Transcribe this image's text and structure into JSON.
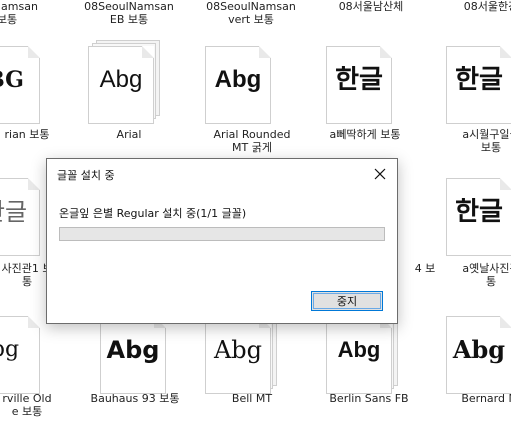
{
  "tiles_top_row_labels": [
    {
      "text": "oulNamsan\n보통"
    },
    {
      "text": "08SeoulNamsan\nEB 보통"
    },
    {
      "text": "08SeoulNamsan\nvert 보통"
    },
    {
      "text": "08서울남산체"
    },
    {
      "text": "08서울한강"
    }
  ],
  "tiles_row1": [
    {
      "sample": "BG",
      "label": "rian 보통",
      "style": "serif-bold"
    },
    {
      "sample": "Abg",
      "label": "Arial",
      "style": "sans"
    },
    {
      "sample": "Abg",
      "label": "Arial Rounded\nMT 굵게",
      "style": "sans-bold"
    },
    {
      "sample": "한글",
      "label": "a뻬딱하게 보통",
      "style": "korean"
    },
    {
      "sample": "한글",
      "label": "a시월구일실\n보통",
      "style": "korean"
    }
  ],
  "tiles_row2": [
    {
      "sample": "한글",
      "label": "사진관1 보\n통",
      "style": "korean-light"
    },
    {
      "sample": "",
      "label": "4 보",
      "style": "hidden"
    },
    {
      "sample": "한글",
      "label": "a옛날사진관\n통",
      "style": "korean"
    }
  ],
  "tiles_row3": [
    {
      "sample": "bg",
      "label": "rville Old\ne 보통",
      "style": "serif"
    },
    {
      "sample": "Abg",
      "label": "Bauhaus 93 보통",
      "style": "bauhaus"
    },
    {
      "sample": "Abg",
      "label": "Bell MT",
      "style": "serif"
    },
    {
      "sample": "Abg",
      "label": "Berlin Sans FB",
      "style": "sans-bold"
    },
    {
      "sample": "Abg",
      "label": "Bernard MT",
      "style": "serif-bold"
    }
  ],
  "dialog": {
    "title": "글꼴 설치 중",
    "status": "온글잎 은별 Regular 설치 중(1/1 글꼴)",
    "progress": 0,
    "stop_label": "중지"
  }
}
